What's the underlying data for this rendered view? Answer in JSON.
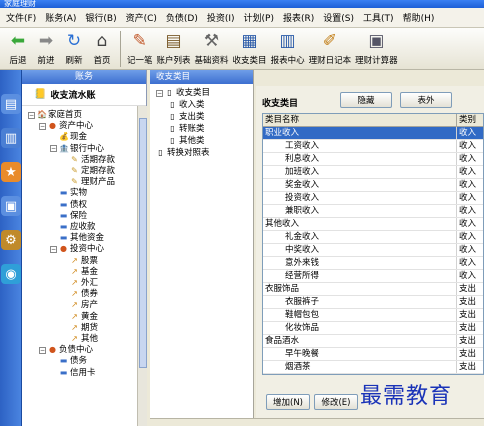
{
  "window": {
    "title": "家庭理财"
  },
  "menu": [
    "文件(F)",
    "账务(A)",
    "银行(B)",
    "资产(C)",
    "负债(D)",
    "投资(I)",
    "计划(P)",
    "报表(R)",
    "设置(S)",
    "工具(T)",
    "帮助(H)"
  ],
  "toolbar": {
    "left": [
      {
        "label": "后退",
        "icon": "back-arrow-icon"
      },
      {
        "label": "前进",
        "icon": "forward-arrow-icon"
      },
      {
        "label": "刷新",
        "icon": "refresh-icon"
      },
      {
        "label": "首页",
        "icon": "home-icon"
      }
    ],
    "right": [
      {
        "label": "记一笔",
        "icon": "pen-icon"
      },
      {
        "label": "账户列表",
        "icon": "account-list-icon"
      },
      {
        "label": "基础资料",
        "icon": "basic-data-icon"
      },
      {
        "label": "收支类目",
        "icon": "category-icon"
      },
      {
        "label": "报表中心",
        "icon": "report-icon"
      },
      {
        "label": "理财日记本",
        "icon": "diary-icon"
      },
      {
        "label": "理财计算器",
        "icon": "calculator-icon"
      }
    ]
  },
  "account_panel": {
    "header": "账务",
    "subheader": "收支流水账",
    "tree": [
      {
        "label": "家庭首页",
        "level": 0,
        "box": "-",
        "icon": "🏠"
      },
      {
        "label": "资产中心",
        "level": 1,
        "box": "-",
        "icon": "●"
      },
      {
        "label": "现金",
        "level": 2,
        "box": "",
        "icon": "💰"
      },
      {
        "label": "银行中心",
        "level": 2,
        "box": "-",
        "icon": "🏦"
      },
      {
        "label": "活期存款",
        "level": 3,
        "box": "",
        "icon": "✎"
      },
      {
        "label": "定期存款",
        "level": 3,
        "box": "",
        "icon": "✎"
      },
      {
        "label": "理财产品",
        "level": 3,
        "box": "",
        "icon": "✎"
      },
      {
        "label": "实物",
        "level": 2,
        "box": "",
        "icon": "▬"
      },
      {
        "label": "债权",
        "level": 2,
        "box": "",
        "icon": "▬"
      },
      {
        "label": "保险",
        "level": 2,
        "box": "",
        "icon": "▬"
      },
      {
        "label": "应收款",
        "level": 2,
        "box": "",
        "icon": "▬"
      },
      {
        "label": "其他资金",
        "level": 2,
        "box": "",
        "icon": "▬"
      },
      {
        "label": "投资中心",
        "level": 2,
        "box": "-",
        "icon": "●"
      },
      {
        "label": "股票",
        "level": 3,
        "box": "",
        "icon": "↗"
      },
      {
        "label": "基金",
        "level": 3,
        "box": "",
        "icon": "↗"
      },
      {
        "label": "外汇",
        "level": 3,
        "box": "",
        "icon": "↗"
      },
      {
        "label": "债券",
        "level": 3,
        "box": "",
        "icon": "↗"
      },
      {
        "label": "房产",
        "level": 3,
        "box": "",
        "icon": "↗"
      },
      {
        "label": "黄金",
        "level": 3,
        "box": "",
        "icon": "↗"
      },
      {
        "label": "期货",
        "level": 3,
        "box": "",
        "icon": "↗"
      },
      {
        "label": "其他",
        "level": 3,
        "box": "",
        "icon": "↗"
      },
      {
        "label": "负债中心",
        "level": 1,
        "box": "-",
        "icon": "●"
      },
      {
        "label": "债务",
        "level": 2,
        "box": "",
        "icon": "▬"
      },
      {
        "label": "信用卡",
        "level": 2,
        "box": "",
        "icon": "▬"
      }
    ]
  },
  "category_tree": {
    "header": "收支类目",
    "items": [
      {
        "label": "收支类目",
        "level": 0,
        "box": "-"
      },
      {
        "label": "收入类",
        "level": 1,
        "box": ""
      },
      {
        "label": "支出类",
        "level": 1,
        "box": ""
      },
      {
        "label": "转账类",
        "level": 1,
        "box": ""
      },
      {
        "label": "其他类",
        "level": 1,
        "box": ""
      },
      {
        "label": "转换对照表",
        "level": 0,
        "box": ""
      }
    ]
  },
  "main": {
    "title": "收支类目",
    "hide_button": "隐藏",
    "export_button": "表外",
    "columns": [
      "类目名称",
      "类别"
    ],
    "rows": [
      {
        "name": "职业收入",
        "type": "收入",
        "indent": 0,
        "selected": true
      },
      {
        "name": "工资收入",
        "type": "收入",
        "indent": 1
      },
      {
        "name": "利息收入",
        "type": "收入",
        "indent": 1
      },
      {
        "name": "加班收入",
        "type": "收入",
        "indent": 1
      },
      {
        "name": "奖金收入",
        "type": "收入",
        "indent": 1
      },
      {
        "name": "投资收入",
        "type": "收入",
        "indent": 1
      },
      {
        "name": "兼职收入",
        "type": "收入",
        "indent": 1
      },
      {
        "name": "其他收入",
        "type": "收入",
        "indent": 0
      },
      {
        "name": "礼金收入",
        "type": "收入",
        "indent": 1
      },
      {
        "name": "中奖收入",
        "type": "收入",
        "indent": 1
      },
      {
        "name": "意外来钱",
        "type": "收入",
        "indent": 1
      },
      {
        "name": "经营所得",
        "type": "收入",
        "indent": 1
      },
      {
        "name": "衣服饰品",
        "type": "支出",
        "indent": 0
      },
      {
        "name": "衣服裤子",
        "type": "支出",
        "indent": 1
      },
      {
        "name": "鞋帽包包",
        "type": "支出",
        "indent": 1
      },
      {
        "name": "化妆饰品",
        "type": "支出",
        "indent": 1
      },
      {
        "name": "食品酒水",
        "type": "支出",
        "indent": 0
      },
      {
        "name": "早午晚餐",
        "type": "支出",
        "indent": 1
      },
      {
        "name": "烟酒茶",
        "type": "支出",
        "indent": 1
      }
    ],
    "add_button": "增加(N)",
    "edit_button": "修改(E)"
  },
  "watermark": "最需教育",
  "colors": {
    "accent": "#316ac5",
    "sidebar": "#3d6fd0",
    "watermark": "#1a33b8"
  }
}
